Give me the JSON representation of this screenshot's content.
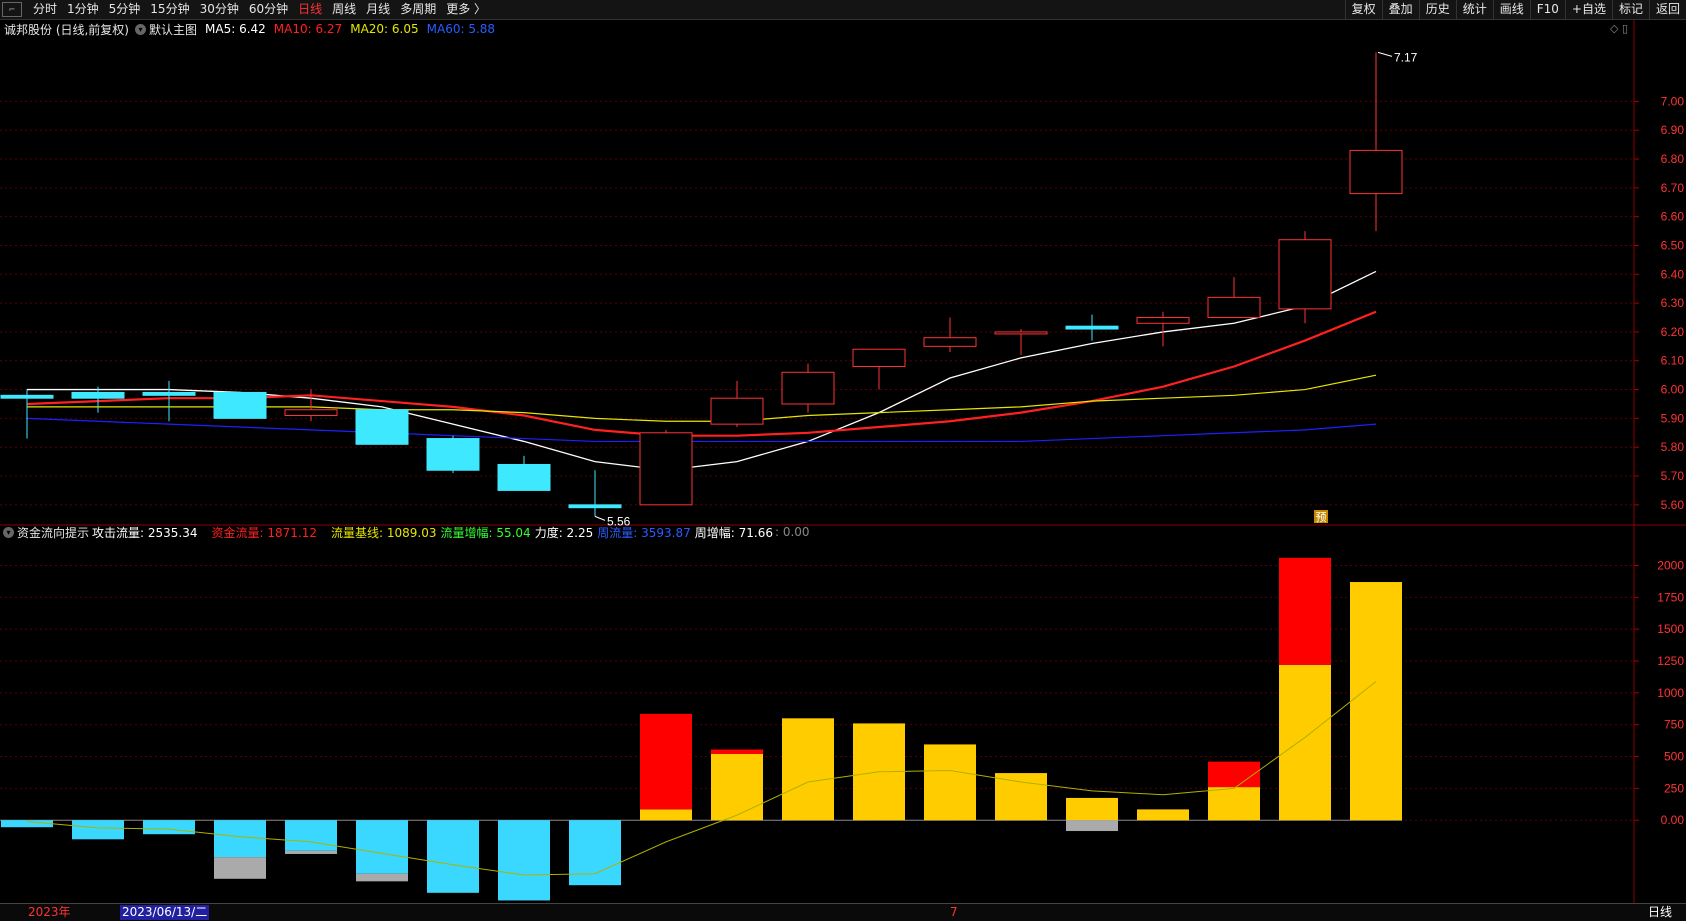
{
  "topbar": {
    "left_items": [
      "分时",
      "1分钟",
      "5分钟",
      "15分钟",
      "30分钟",
      "60分钟",
      "日线",
      "周线",
      "月线",
      "多周期",
      "更多 〉"
    ],
    "active": "日线",
    "right_items": [
      "复权",
      "叠加",
      "历史",
      "统计",
      "画线",
      "F10",
      "+自选",
      "标记",
      "返回"
    ]
  },
  "main_info": {
    "stock": "诚邦股份 (日线,前复权)",
    "view": "默认主图",
    "ma5": "MA5: 6.42",
    "ma10": "MA10: 6.27",
    "ma20": "MA20: 6.05",
    "ma60": "MA60: 5.88"
  },
  "sub_info": {
    "name": "资金流向提示",
    "attack": "攻击流量: 2535.34",
    "capital": "资金流量: 1871.12",
    "base": "流量基线: 1089.03",
    "growth": "流量增幅: 55.04",
    "force": "力度: 2.25",
    "week": "周流量: 3593.87",
    "week_growth": "周增幅: 71.66",
    "extra": ": 0.00"
  },
  "colors": {
    "up": "#ff3333",
    "down": "#3ee8ff",
    "ma5": "#ffffff",
    "ma10": "#ff2020",
    "ma20": "#e6e600",
    "ma60": "#2020ff",
    "bar_yellow": "#ffcc00",
    "bar_red": "#ff0000",
    "bar_cyan": "#3ad8ff",
    "bar_gray": "#aaaaaa"
  },
  "bottom": {
    "year": "2023年",
    "cursor_date": "2023/06/13/二",
    "month": "7",
    "period": "日线"
  },
  "chart_data": [
    {
      "type": "candlestick",
      "title": "",
      "y_ticks": [
        5.6,
        5.7,
        5.8,
        5.9,
        6.0,
        6.1,
        6.2,
        6.3,
        6.4,
        6.5,
        6.6,
        6.7,
        6.8,
        6.9,
        7.0
      ],
      "ylim": [
        5.53,
        7.22
      ],
      "high_label": "7.17",
      "low_label": "5.56",
      "marker": "预",
      "candles": [
        {
          "o": 5.98,
          "h": 6.0,
          "l": 5.83,
          "c": 5.97
        },
        {
          "o": 5.99,
          "h": 6.01,
          "l": 5.92,
          "c": 5.97
        },
        {
          "o": 5.99,
          "h": 6.03,
          "l": 5.89,
          "c": 5.98
        },
        {
          "o": 5.99,
          "h": 5.99,
          "l": 5.9,
          "c": 5.9
        },
        {
          "o": 5.91,
          "h": 6.0,
          "l": 5.89,
          "c": 5.93
        },
        {
          "o": 5.93,
          "h": 5.93,
          "l": 5.81,
          "c": 5.81
        },
        {
          "o": 5.83,
          "h": 5.84,
          "l": 5.71,
          "c": 5.72
        },
        {
          "o": 5.74,
          "h": 5.77,
          "l": 5.65,
          "c": 5.65
        },
        {
          "o": 5.6,
          "h": 5.72,
          "l": 5.56,
          "c": 5.59
        },
        {
          "o": 5.6,
          "h": 5.86,
          "l": 5.6,
          "c": 5.85
        },
        {
          "o": 5.88,
          "h": 6.03,
          "l": 5.87,
          "c": 5.97
        },
        {
          "o": 5.95,
          "h": 6.09,
          "l": 5.92,
          "c": 6.06
        },
        {
          "o": 6.08,
          "h": 6.14,
          "l": 6.0,
          "c": 6.14
        },
        {
          "o": 6.15,
          "h": 6.25,
          "l": 6.13,
          "c": 6.18
        },
        {
          "o": 6.2,
          "h": 6.21,
          "l": 6.12,
          "c": 6.2
        },
        {
          "o": 6.22,
          "h": 6.26,
          "l": 6.17,
          "c": 6.21
        },
        {
          "o": 6.23,
          "h": 6.27,
          "l": 6.15,
          "c": 6.25
        },
        {
          "o": 6.25,
          "h": 6.39,
          "l": 6.25,
          "c": 6.32
        },
        {
          "o": 6.28,
          "h": 6.55,
          "l": 6.23,
          "c": 6.52
        },
        {
          "o": 6.68,
          "h": 7.17,
          "l": 6.55,
          "c": 6.83
        }
      ],
      "ma": [
        {
          "name": "MA5",
          "values": [
            6.0,
            6.0,
            6.0,
            5.99,
            5.97,
            5.94,
            5.88,
            5.82,
            5.75,
            5.72,
            5.75,
            5.82,
            5.92,
            6.04,
            6.11,
            6.16,
            6.2,
            6.23,
            6.29,
            6.41
          ]
        },
        {
          "name": "MA10",
          "values": [
            5.95,
            5.96,
            5.97,
            5.97,
            5.98,
            5.96,
            5.94,
            5.91,
            5.86,
            5.84,
            5.84,
            5.85,
            5.87,
            5.89,
            5.92,
            5.96,
            6.01,
            6.08,
            6.17,
            6.27
          ]
        },
        {
          "name": "MA20",
          "values": [
            5.94,
            5.94,
            5.94,
            5.94,
            5.94,
            5.93,
            5.93,
            5.92,
            5.9,
            5.89,
            5.89,
            5.91,
            5.92,
            5.93,
            5.94,
            5.96,
            5.97,
            5.98,
            6.0,
            6.05
          ]
        },
        {
          "name": "MA60",
          "values": [
            5.9,
            5.89,
            5.88,
            5.87,
            5.86,
            5.85,
            5.84,
            5.83,
            5.82,
            5.82,
            5.82,
            5.82,
            5.82,
            5.82,
            5.82,
            5.83,
            5.84,
            5.85,
            5.86,
            5.88
          ]
        }
      ]
    },
    {
      "type": "bar",
      "title": "",
      "y_ticks": [
        0,
        250,
        500,
        750,
        1000,
        1250,
        1500,
        1750,
        2000
      ],
      "ylim": [
        -650,
        2200
      ],
      "bars": [
        {
          "main": -55,
          "extra": 0
        },
        {
          "main": -150,
          "extra": 0
        },
        {
          "main": -110,
          "extra": 0
        },
        {
          "main": -290,
          "extra": -170
        },
        {
          "main": -240,
          "extra": -25
        },
        {
          "main": -420,
          "extra": -60
        },
        {
          "main": -570,
          "extra": 0
        },
        {
          "main": -630,
          "extra": 0
        },
        {
          "main": -510,
          "extra": 0
        },
        {
          "main": 85,
          "extra": 750
        },
        {
          "main": 520,
          "extra": 35
        },
        {
          "main": 800,
          "extra": 0
        },
        {
          "main": 760,
          "extra": 0
        },
        {
          "main": 595,
          "extra": 0
        },
        {
          "main": 370,
          "extra": 0
        },
        {
          "main": 175,
          "extra": -85
        },
        {
          "main": 85,
          "extra": 0
        },
        {
          "main": 260,
          "extra": 200
        },
        {
          "main": 1220,
          "extra": 840
        },
        {
          "main": 1870,
          "extra": 0
        }
      ],
      "line": [
        -10,
        -60,
        -70,
        -130,
        -170,
        -260,
        -350,
        -430,
        -420,
        -170,
        40,
        300,
        380,
        390,
        300,
        230,
        200,
        250,
        650,
        1089
      ]
    }
  ]
}
